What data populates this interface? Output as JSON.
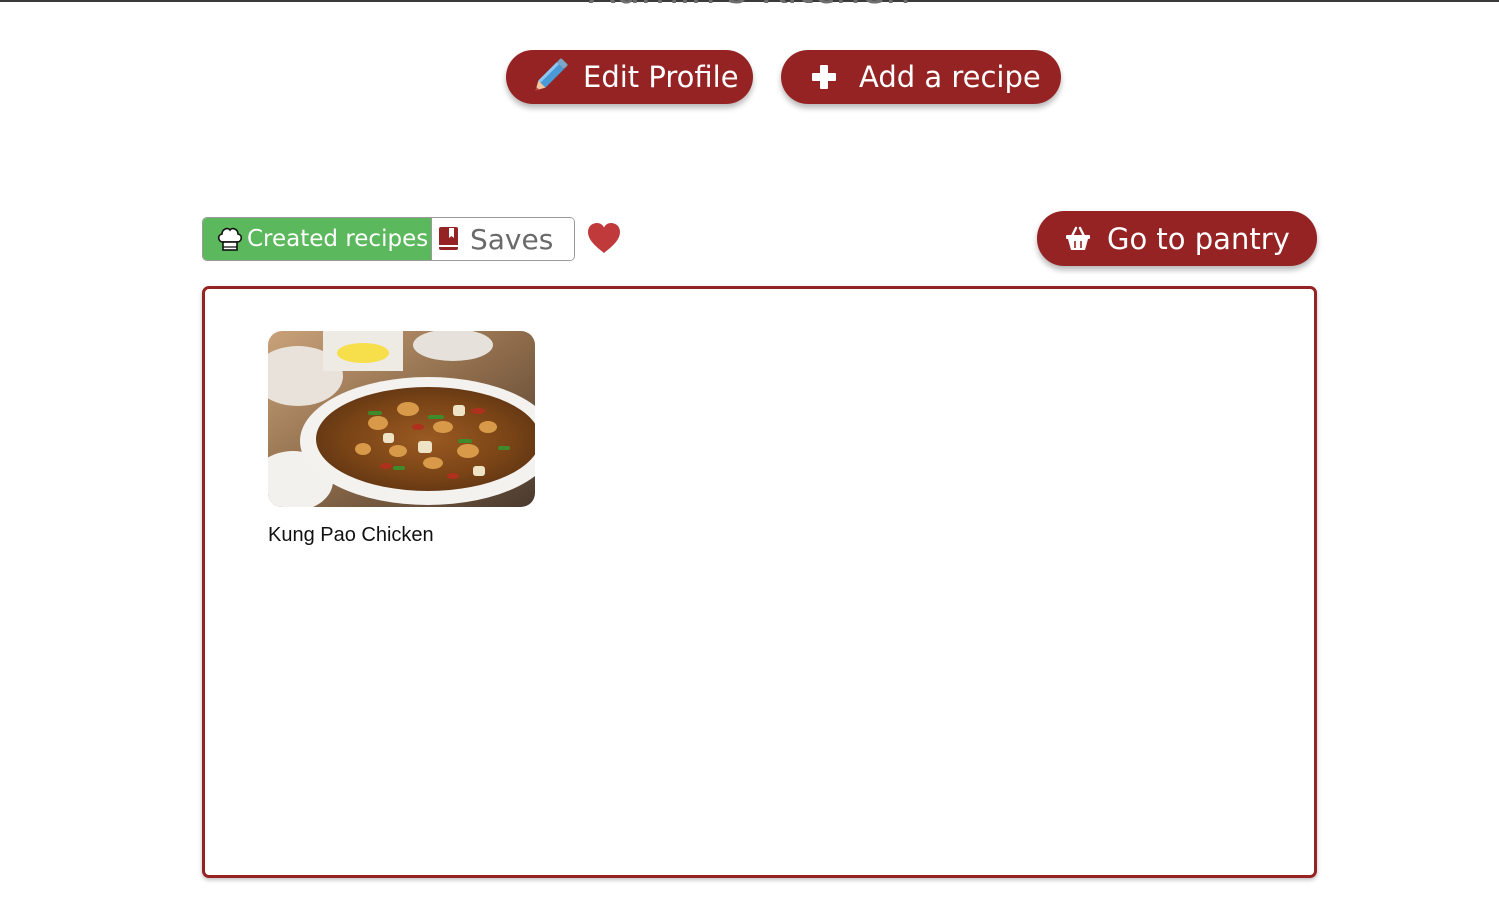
{
  "page": {
    "title": "Admin's Kitchen"
  },
  "actions": {
    "edit_profile_label": "Edit Profile",
    "add_recipe_label": "Add a recipe",
    "go_pantry_label": "Go to pantry"
  },
  "tabs": {
    "created_label": "Created recipes",
    "saves_label": "Saves",
    "active": "created"
  },
  "recipes": [
    {
      "name": "Kung Pao Chicken",
      "image": "kung-pao-chicken-photo"
    }
  ],
  "colors": {
    "accent": "#962323",
    "active_tab": "#5cb85c",
    "heart": "#c0393b",
    "title": "#6e6e6e"
  },
  "icons": {
    "edit_profile": "pencil-icon",
    "add_recipe": "plus-icon",
    "go_pantry": "basket-icon",
    "created": "chef-hat-icon",
    "saves": "bookmark-icon",
    "favorites": "heart-icon"
  }
}
